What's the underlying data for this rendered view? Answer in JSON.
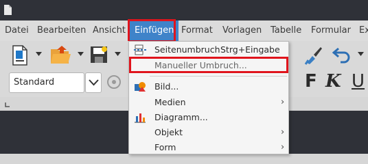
{
  "menubar": {
    "items": [
      {
        "label": "Datei"
      },
      {
        "label": "Bearbeiten"
      },
      {
        "label": "Ansicht"
      },
      {
        "label": "Einfügen"
      },
      {
        "label": "Format"
      },
      {
        "label": "Vorlagen"
      },
      {
        "label": "Tabelle"
      },
      {
        "label": "Formular"
      },
      {
        "label": "Ex"
      }
    ],
    "active_index": 3
  },
  "toolbar": {
    "style_value": "Standard",
    "bold_label": "F",
    "italic_label": "K",
    "underline_label": "U",
    "icons": [
      "new-document-icon",
      "open-folder-icon",
      "save-icon",
      "navigator-icon",
      "clone-formatting-icon",
      "undo-icon",
      "chevron-down-icon"
    ]
  },
  "insert_menu": {
    "items": [
      {
        "label": "Seitenumbruch",
        "shortcut": "Strg+Eingabe",
        "icon": "page-break-icon",
        "submenu": false
      },
      {
        "label": "Manueller Umbruch...",
        "shortcut": "",
        "icon": "",
        "submenu": false
      },
      {
        "label": "Bild...",
        "shortcut": "",
        "icon": "image-icon",
        "submenu": false
      },
      {
        "label": "Medien",
        "shortcut": "",
        "icon": "",
        "submenu": true
      },
      {
        "label": "Diagramm...",
        "shortcut": "",
        "icon": "chart-icon",
        "submenu": false
      },
      {
        "label": "Objekt",
        "shortcut": "",
        "icon": "",
        "submenu": true
      },
      {
        "label": "Form",
        "shortcut": "",
        "icon": "",
        "submenu": true
      }
    ]
  },
  "colors": {
    "highlight_red": "#e0141c",
    "menu_active_blue": "#3f83c9",
    "dark_background": "#2f3138"
  }
}
